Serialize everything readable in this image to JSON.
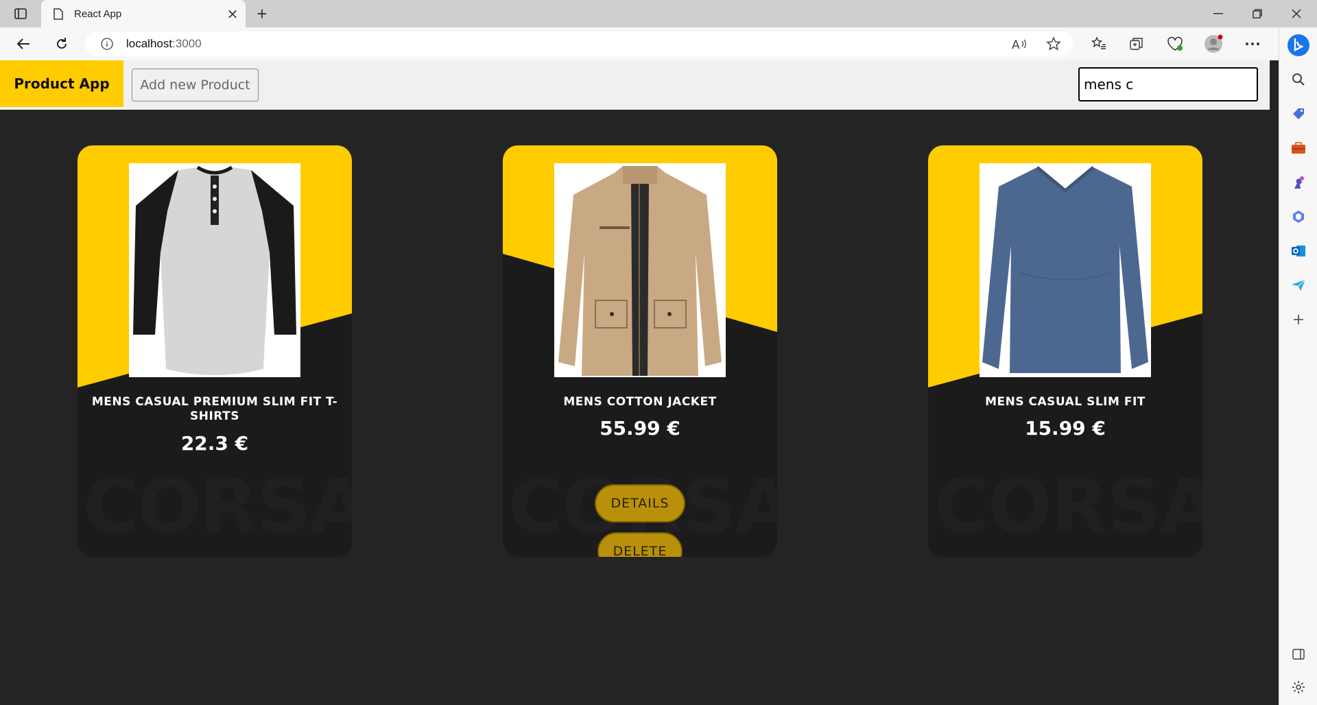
{
  "browser": {
    "tab_title": "React App",
    "url_host": "localhost",
    "url_port": ":3000"
  },
  "navbar": {
    "brand": "Product App",
    "add_label": "Add new Product",
    "search_value": "mens c"
  },
  "products": [
    {
      "name": "MENS CASUAL PREMIUM SLIM FIT T-SHIRTS",
      "price": "22.3 €",
      "watermark": "CORSA",
      "image": "raglan-tshirt"
    },
    {
      "name": "MENS COTTON JACKET",
      "price": "55.99 €",
      "watermark": "CORSA",
      "image": "cotton-jacket",
      "details_label": "DETAILS",
      "delete_label": "DELETE"
    },
    {
      "name": "MENS CASUAL SLIM FIT",
      "price": "15.99 €",
      "watermark": "CORSA",
      "image": "blue-longsleeve"
    }
  ],
  "colors": {
    "accent": "#ffcc00",
    "background": "#242424",
    "card": "#1b1b1b",
    "button": "#b8900a"
  }
}
